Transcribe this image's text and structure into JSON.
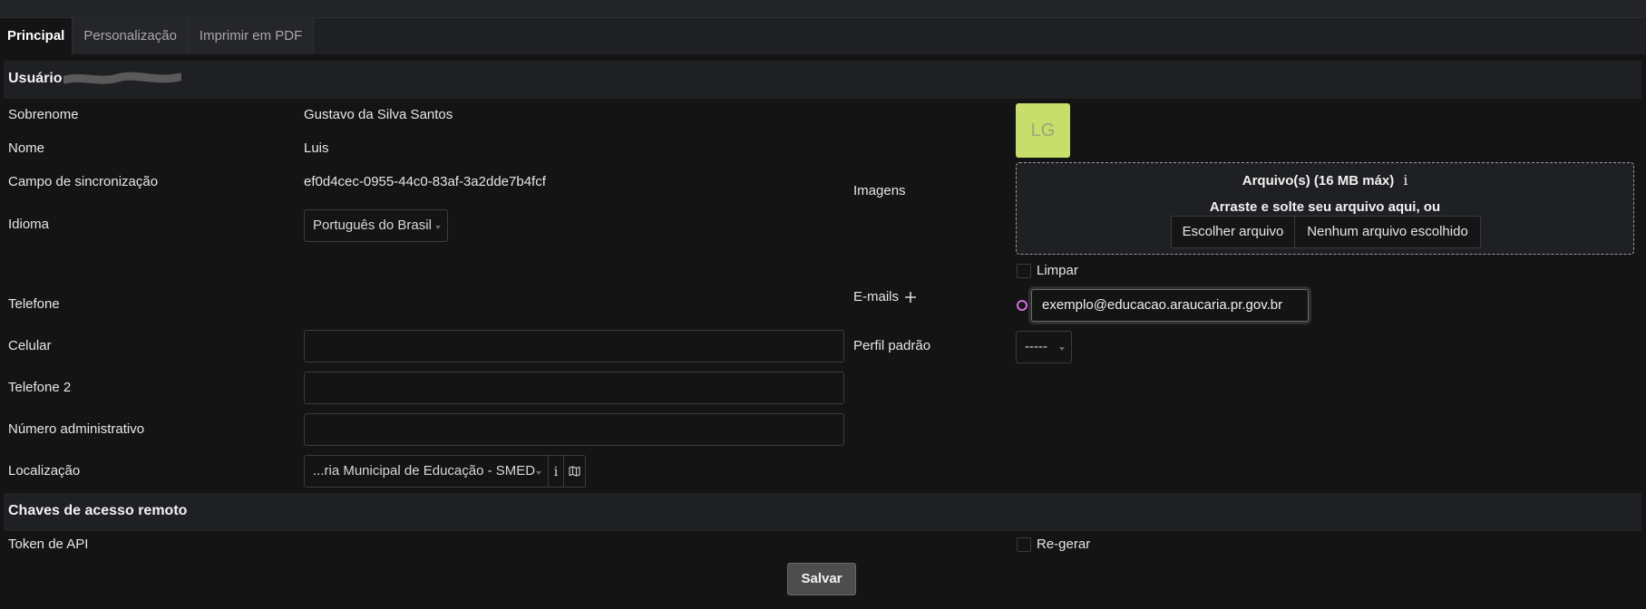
{
  "tabs": [
    {
      "label": "Principal",
      "active": true
    },
    {
      "label": "Personalização",
      "active": false
    },
    {
      "label": "Imprimir em PDF",
      "active": false
    }
  ],
  "user_section": {
    "title": "Usuário"
  },
  "fields": {
    "sobrenome": {
      "label": "Sobrenome",
      "value": "Gustavo da Silva Santos"
    },
    "nome": {
      "label": "Nome",
      "value": "Luis"
    },
    "sync": {
      "label": "Campo de sincronização",
      "value": "ef0d4cec-0955-44c0-83af-3a2dde7b4fcf"
    },
    "idioma": {
      "label": "Idioma",
      "value": "Português do Brasil"
    },
    "telefone": {
      "label": "Telefone"
    },
    "celular": {
      "label": "Celular",
      "value": ""
    },
    "telefone2": {
      "label": "Telefone 2",
      "value": ""
    },
    "numero_admin": {
      "label": "Número administrativo",
      "value": ""
    },
    "localizacao": {
      "label": "Localização",
      "value": "...ria Municipal de Educação - SMED"
    }
  },
  "right": {
    "avatar_initials": "LG",
    "avatar_color": "#c7dd6c",
    "images_label": "Imagens",
    "dropzone_title": "Arquivo(s) (16 MB máx)",
    "dropzone_sub": "Arraste e solte seu arquivo aqui, ou",
    "choose_file": "Escolher arquivo",
    "no_file": "Nenhum arquivo escolhido",
    "clear_label": "Limpar",
    "emails_label": "E-mails",
    "email_value": "exemplo@educacao.araucaria.pr.gov.br",
    "perfil_label": "Perfil padrão",
    "perfil_value": "-----"
  },
  "remote_section": {
    "title": "Chaves de acesso remoto"
  },
  "api": {
    "label": "Token de API",
    "regen_label": "Re-gerar"
  },
  "save_label": "Salvar",
  "icons": {
    "info": "info-icon",
    "map": "map-icon",
    "plus": "plus-icon"
  }
}
